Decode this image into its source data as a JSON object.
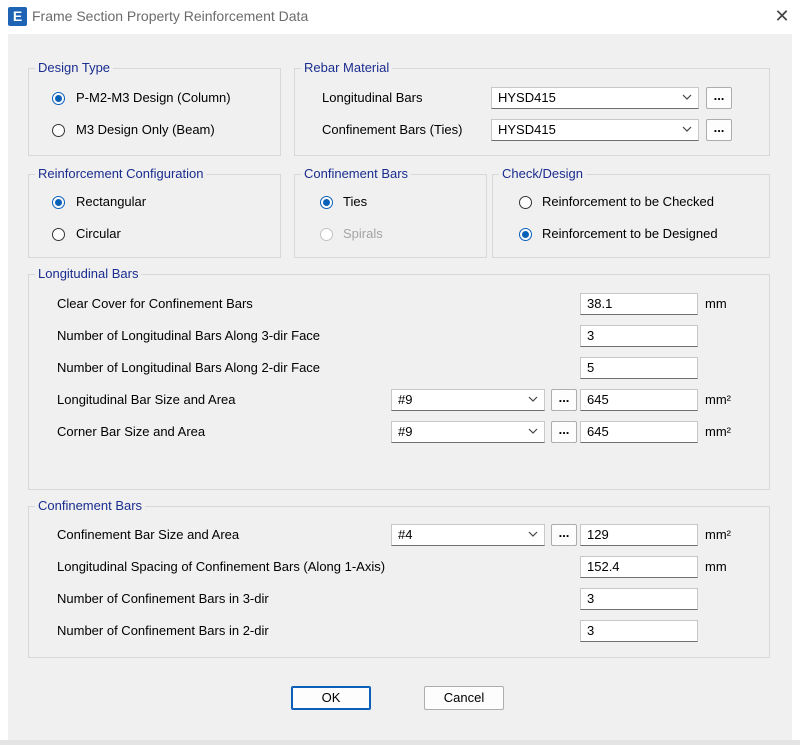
{
  "window": {
    "icon_letter": "E",
    "title": "Frame Section Property Reinforcement Data",
    "close_glyph": "✕"
  },
  "design_type": {
    "label": "Design Type",
    "options": [
      "P-M2-M3 Design  (Column)",
      "M3 Design Only  (Beam)"
    ],
    "selected": 0
  },
  "rebar_material": {
    "label": "Rebar Material",
    "longitudinal_label": "Longitudinal Bars",
    "longitudinal_value": "HYSD415",
    "confinement_label": "Confinement Bars (Ties)",
    "confinement_value": "HYSD415"
  },
  "reinforcement_configuration": {
    "label": "Reinforcement Configuration",
    "options": [
      "Rectangular",
      "Circular"
    ],
    "selected": 0
  },
  "confinement_type": {
    "label": "Confinement Bars",
    "options": [
      "Ties",
      "Spirals"
    ],
    "selected": 0
  },
  "check_design": {
    "label": "Check/Design",
    "options": [
      "Reinforcement to be Checked",
      "Reinforcement to be Designed"
    ],
    "selected": 1
  },
  "longitudinal_bars": {
    "label": "Longitudinal Bars",
    "clear_cover_label": "Clear Cover for Confinement Bars",
    "clear_cover_value": "38.1",
    "clear_cover_unit": "mm",
    "num_3dir_label": "Number of Longitudinal Bars Along 3-dir Face",
    "num_3dir_value": "3",
    "num_2dir_label": "Number of Longitudinal Bars Along 2-dir Face",
    "num_2dir_value": "5",
    "bar_size_label": "Longitudinal Bar Size and Area",
    "bar_size_value": "#9",
    "bar_area_value": "645",
    "bar_area_unit": "mm²",
    "corner_label": "Corner Bar Size and Area",
    "corner_size_value": "#9",
    "corner_area_value": "645",
    "corner_area_unit": "mm²"
  },
  "confinement_bars": {
    "label": "Confinement Bars",
    "size_label": "Confinement Bar Size and Area",
    "size_value": "#4",
    "area_value": "129",
    "area_unit": "mm²",
    "spacing_label": "Longitudinal Spacing of Confinement Bars  (Along 1-Axis)",
    "spacing_value": "152.4",
    "spacing_unit": "mm",
    "num_3dir_label": "Number of Confinement Bars in 3-dir",
    "num_3dir_value": "3",
    "num_2dir_label": "Number of Confinement Bars in 2-dir",
    "num_2dir_value": "3"
  },
  "browse_label": "...",
  "buttons": {
    "ok": "OK",
    "cancel": "Cancel"
  }
}
